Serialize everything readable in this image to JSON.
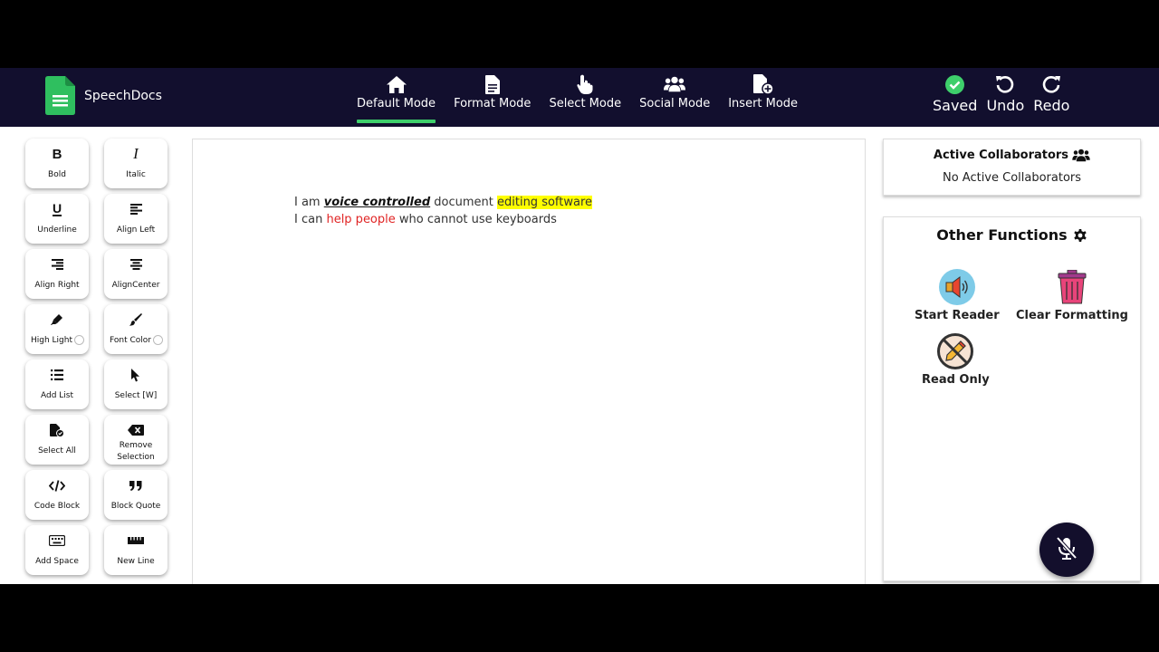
{
  "app": {
    "name": "SpeechDocs"
  },
  "modes": [
    {
      "label": "Default Mode",
      "icon": "home-icon",
      "active": true
    },
    {
      "label": "Format Mode",
      "icon": "document-icon",
      "active": false
    },
    {
      "label": "Select Mode",
      "icon": "pointer-hand-icon",
      "active": false
    },
    {
      "label": "Social Mode",
      "icon": "users-icon",
      "active": false
    },
    {
      "label": "Insert Mode",
      "icon": "file-plus-icon",
      "active": false
    }
  ],
  "status": {
    "saved_label": "Saved",
    "undo_label": "Undo",
    "redo_label": "Redo"
  },
  "toolbar": [
    {
      "label": "Bold",
      "icon": "bold-icon"
    },
    {
      "label": "Italic",
      "icon": "italic-icon"
    },
    {
      "label": "Underline",
      "icon": "underline-icon"
    },
    {
      "label": "Align Left",
      "icon": "align-left-icon"
    },
    {
      "label": "Align Right",
      "icon": "align-right-icon"
    },
    {
      "label": "AlignCenter",
      "icon": "align-center-icon"
    },
    {
      "label": "High Light",
      "icon": "highlighter-icon"
    },
    {
      "label": "Font Color",
      "icon": "paint-brush-icon"
    },
    {
      "label": "Add List",
      "icon": "list-icon"
    },
    {
      "label": "Select [W]",
      "icon": "cursor-arrow-icon"
    },
    {
      "label": "Select All",
      "icon": "file-check-icon"
    },
    {
      "label": "Remove Selection",
      "icon": "backspace-icon"
    },
    {
      "label": "Code Block",
      "icon": "code-icon"
    },
    {
      "label": "Block Quote",
      "icon": "quote-icon"
    },
    {
      "label": "Add Space",
      "icon": "keyboard-icon"
    },
    {
      "label": "New Line",
      "icon": "ruler-icon"
    }
  ],
  "document": {
    "line1": {
      "t1": "I am ",
      "t2": "voice controlled",
      "t3": " document ",
      "t4": "editing software"
    },
    "line2": {
      "t1": "I can ",
      "t2": "help people",
      "t3": " who cannot use keyboards"
    }
  },
  "collaborators": {
    "title": "Active Collaborators",
    "empty_text": "No Active Collaborators"
  },
  "functions": {
    "title": "Other Functions",
    "items": [
      {
        "label": "Start Reader",
        "icon": "speaker-icon"
      },
      {
        "label": "Clear Formatting",
        "icon": "trash-bin-icon"
      },
      {
        "label": "Read Only",
        "icon": "no-pencil-icon"
      }
    ]
  },
  "colors": {
    "navbar": "#120f2e",
    "active_underline": "#3ecf6b",
    "highlight": "#ffff00",
    "red_text": "#e02424",
    "saved_check": "#3ecf6b",
    "mic_button": "#130f2c"
  }
}
